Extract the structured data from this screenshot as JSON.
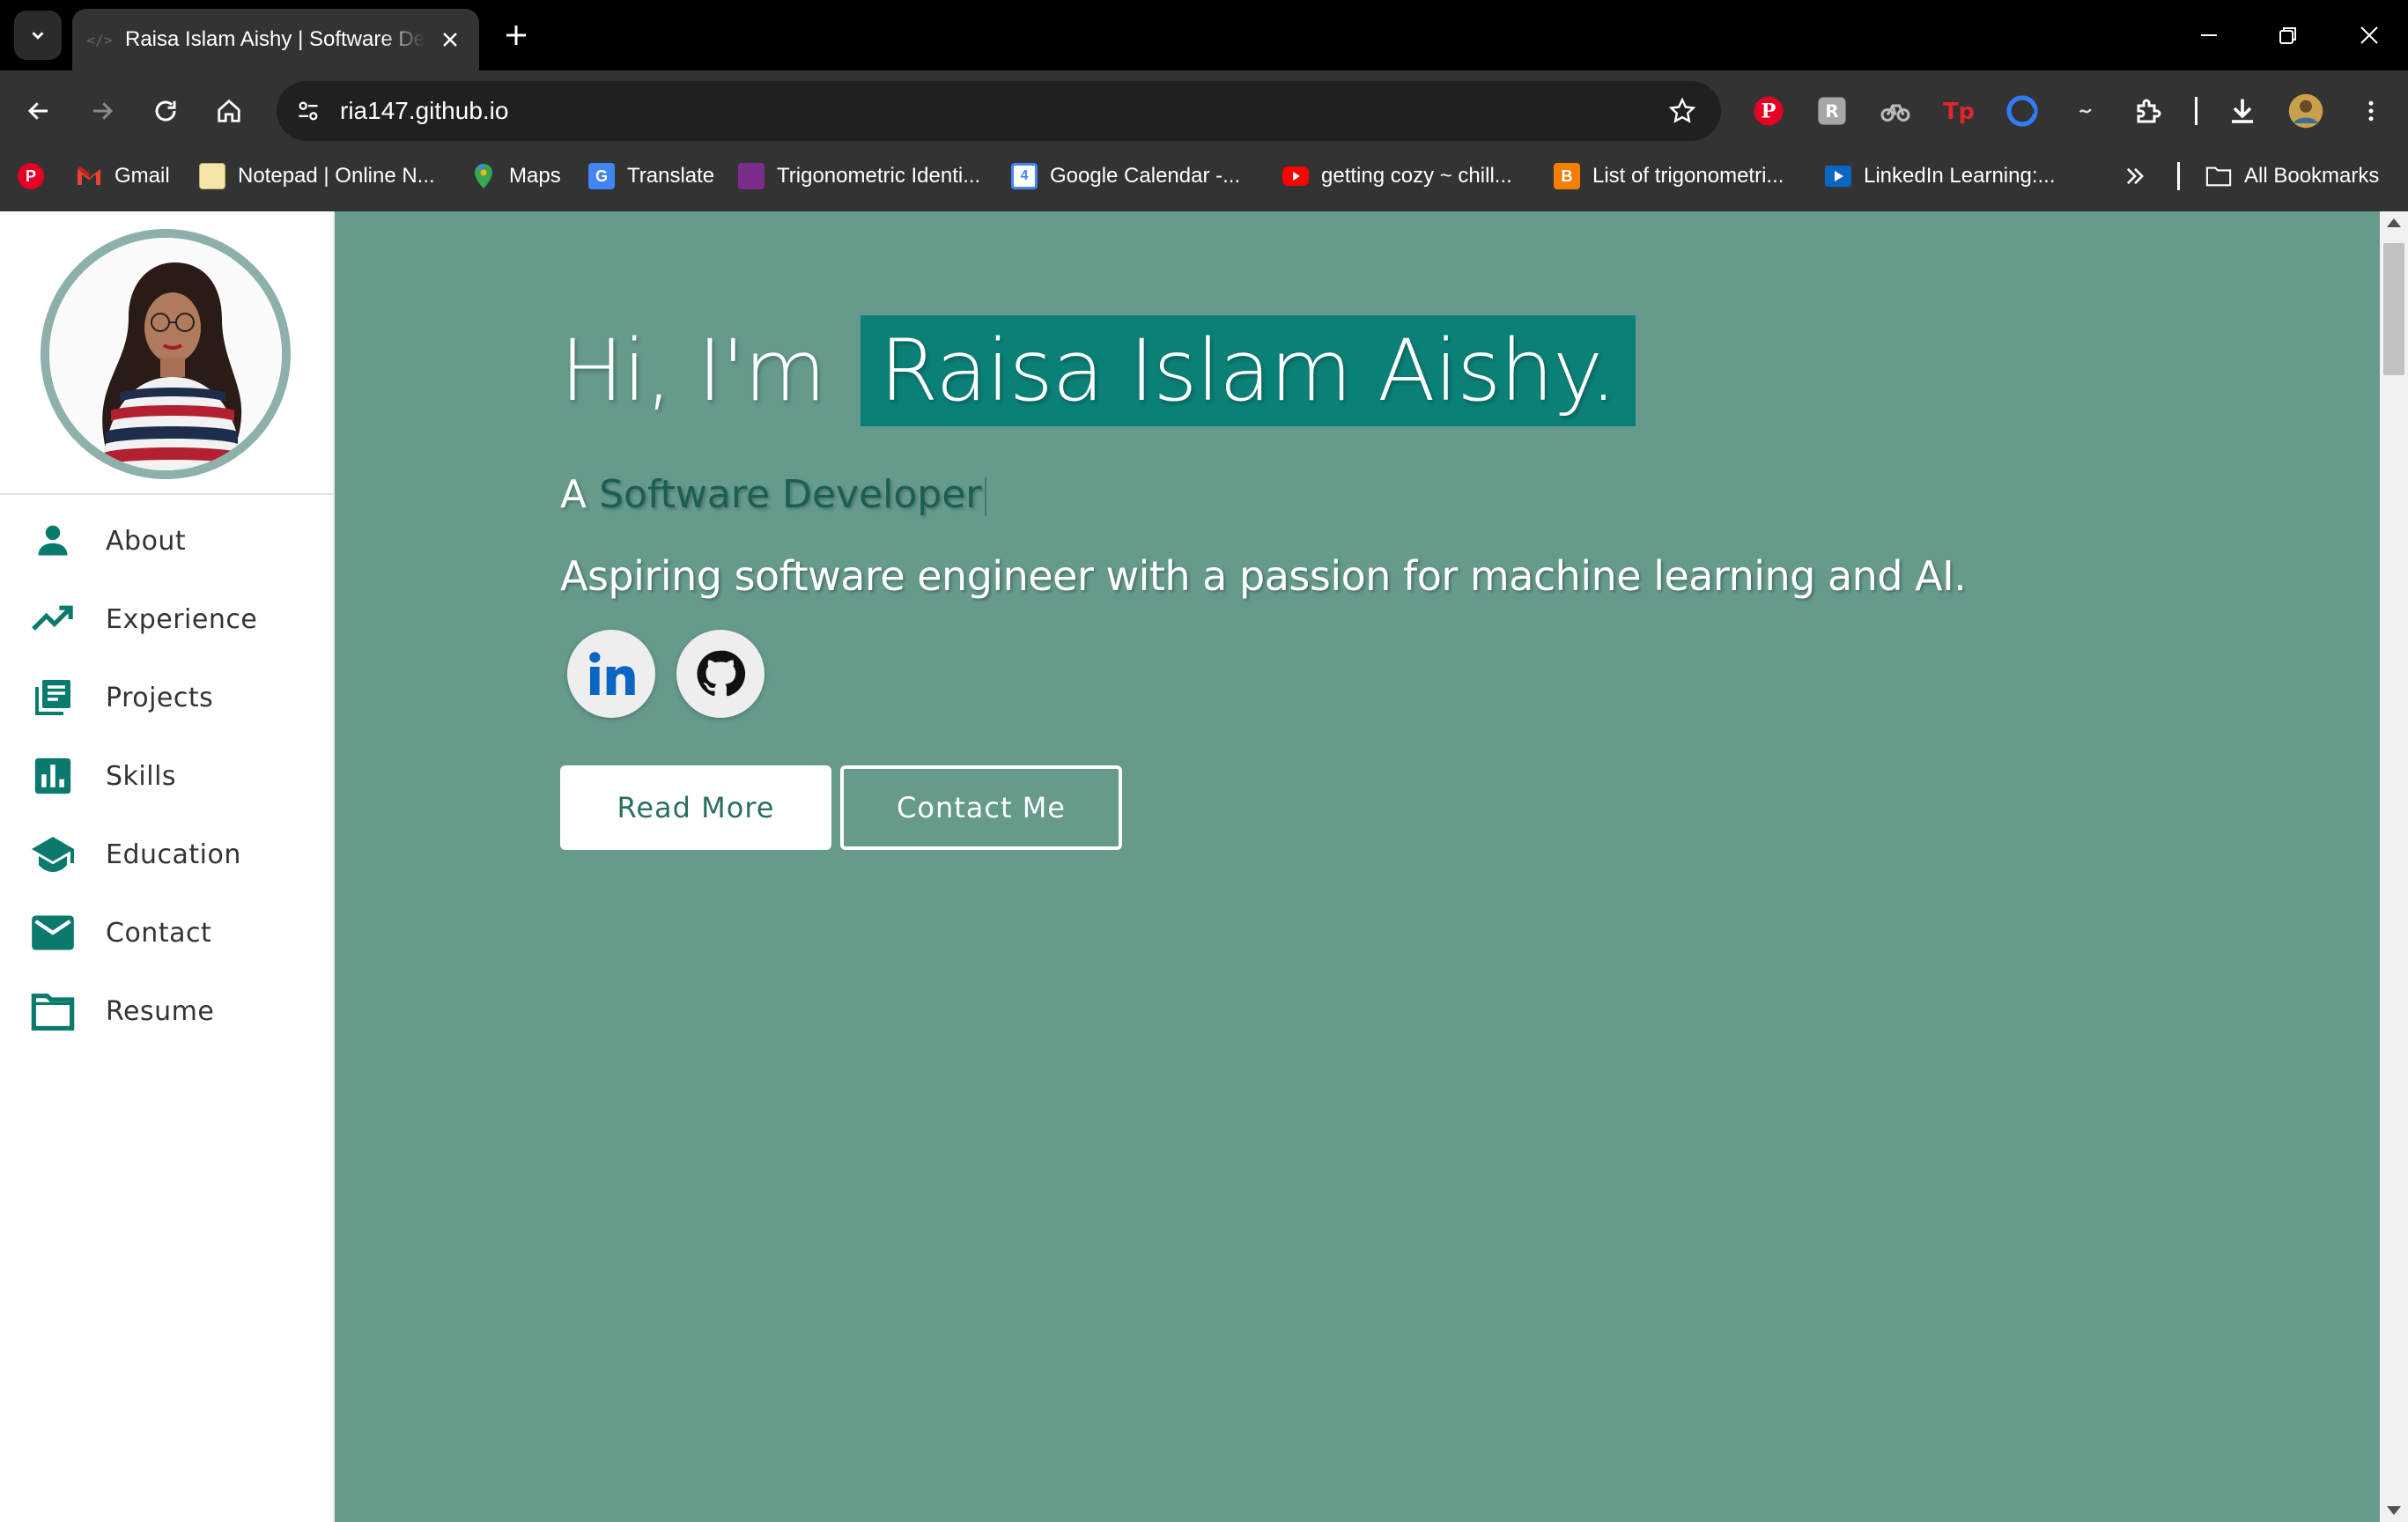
{
  "browser": {
    "tab_title": "Raisa Islam Aishy | Software Developer",
    "favicon_text": "</>",
    "url": "ria147.github.io",
    "bookmarks": [
      {
        "label": "",
        "icon": "pinterest-icon",
        "color": "#e60023"
      },
      {
        "label": "Gmail",
        "icon": "gmail-icon",
        "color": "#ea4335"
      },
      {
        "label": "Notepad | Online N...",
        "icon": "notepad-icon",
        "color": "#f5e6a8"
      },
      {
        "label": "Maps",
        "icon": "maps-icon",
        "color": "#34a853"
      },
      {
        "label": "Translate",
        "icon": "translate-icon",
        "color": "#4285f4"
      },
      {
        "label": "Trigonometric Identi...",
        "icon": "trig-icon",
        "color": "#7b2d8e"
      },
      {
        "label": "Google Calendar -...",
        "icon": "calendar-icon",
        "color": "#4285f4"
      },
      {
        "label": "getting cozy ~ chill...",
        "icon": "youtube-icon",
        "color": "#ff0000"
      },
      {
        "label": "List of trigonometri...",
        "icon": "blogger-icon",
        "color": "#f57d00"
      },
      {
        "label": "LinkedIn Learning:...",
        "icon": "linkedin-learning-icon",
        "color": "#0a66c2"
      }
    ],
    "calendar_glyph": "4",
    "all_bookmarks": "All Bookmarks"
  },
  "sidebar": {
    "nav": [
      {
        "label": "About",
        "icon": "person-icon"
      },
      {
        "label": "Experience",
        "icon": "trending-up-icon"
      },
      {
        "label": "Projects",
        "icon": "library-books-icon"
      },
      {
        "label": "Skills",
        "icon": "bar-chart-icon"
      },
      {
        "label": "Education",
        "icon": "school-icon"
      },
      {
        "label": "Contact",
        "icon": "mail-icon"
      },
      {
        "label": "Resume",
        "icon": "folder-icon"
      }
    ]
  },
  "hero": {
    "greeting": "Hi, I'm",
    "name": "Raisa Islam Aishy.",
    "subtitle_prefix": "A",
    "role": "Software Developer",
    "tagline": "Aspiring software engineer with a passion for machine learning and AI.",
    "buttons": {
      "read_more": "Read More",
      "contact": "Contact Me"
    },
    "socials": [
      {
        "name": "LinkedIn",
        "icon": "linkedin-icon",
        "label": "in"
      },
      {
        "name": "GitHub",
        "icon": "github-icon"
      }
    ]
  },
  "colors": {
    "hero_bg": "#659a8d",
    "name_highlight": "#0b8077",
    "nav_icon": "#0b7a6e"
  }
}
